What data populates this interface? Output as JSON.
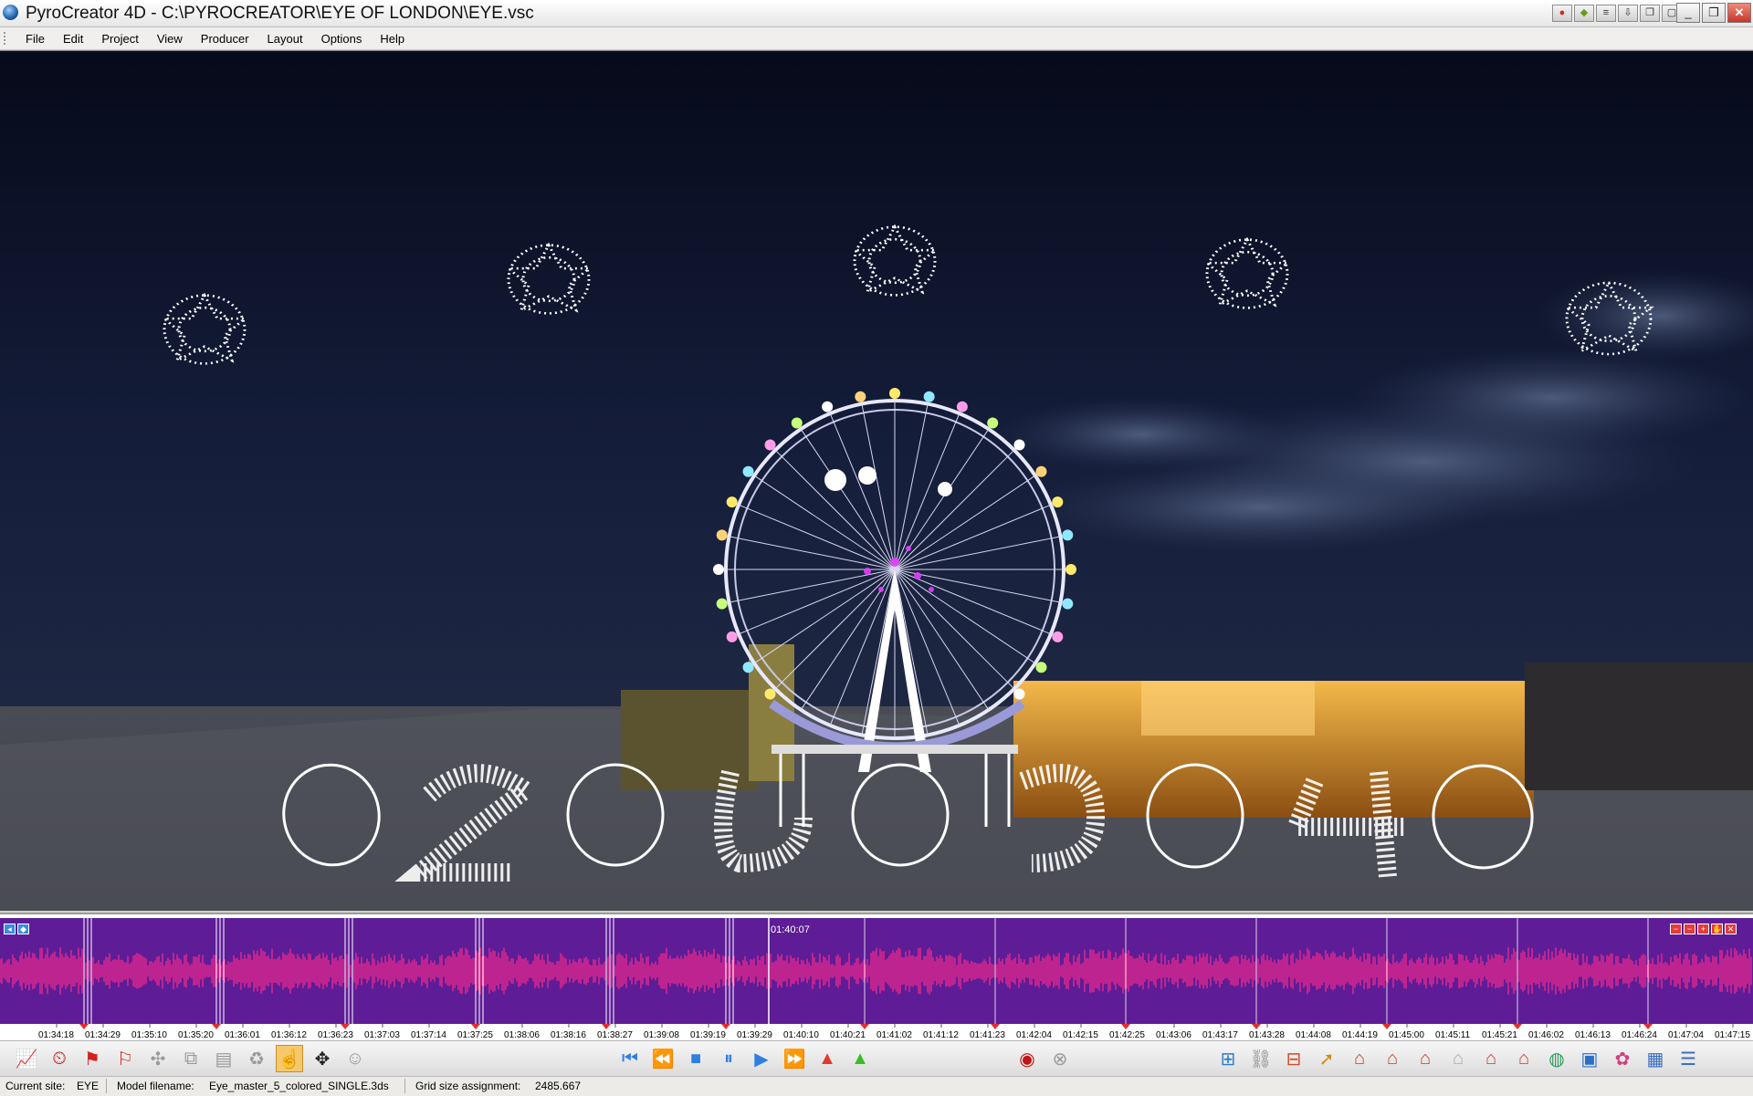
{
  "window": {
    "title": "PyroCreator 4D - C:\\PYROCREATOR\\EYE OF LONDON\\EYE.vsc"
  },
  "menu": {
    "items": [
      "File",
      "Edit",
      "Project",
      "View",
      "Producer",
      "Layout",
      "Options",
      "Help"
    ]
  },
  "timeline": {
    "playhead_time": "01:40:07",
    "tick_labels": [
      "01:34:18",
      "01:34:29",
      "01:35:10",
      "01:35:20",
      "01:36:01",
      "01:36:12",
      "01:36:23",
      "01:37:03",
      "01:37:14",
      "01:37:25",
      "01:38:06",
      "01:38:16",
      "01:38:27",
      "01:39:08",
      "01:39:19",
      "01:39:29",
      "01:40:10",
      "01:40:21",
      "01:41:02",
      "01:41:12",
      "01:41:23",
      "01:42:04",
      "01:42:15",
      "01:42:25",
      "01:43:06",
      "01:43:17",
      "01:43:28",
      "01:44:08",
      "01:44:19",
      "01:45:00",
      "01:45:11",
      "01:45:21",
      "01:46:02",
      "01:46:13",
      "01:46:24",
      "01:47:04",
      "01:47:15"
    ],
    "colors": {
      "background": "#5e1d97",
      "waveform": "#ff2a8a",
      "marker": "#e03030"
    }
  },
  "toolbar": {
    "left_tools": [
      "chart-edit-icon",
      "clock-icon",
      "red-flag-icon",
      "red-flag-a-icon",
      "puzzle-icon",
      "copy-icon",
      "paste-icon",
      "recycle-icon",
      "hand-pointer-icon",
      "move-arrows-icon",
      "person-icon"
    ],
    "transport": [
      "skip-start-icon",
      "rewind-icon",
      "stop-icon",
      "pause-icon",
      "play-icon",
      "fast-forward-icon",
      "red-triangle-icon",
      "green-triangle-icon"
    ],
    "record": [
      "record-icon",
      "disabled-record-icon"
    ],
    "right_tools": [
      "network-icon",
      "link-icon",
      "hierarchy-icon",
      "pointer-icon",
      "house-icon",
      "house-arrow-icon",
      "house-cross-icon",
      "house-faded-icon",
      "house-plus-icon",
      "house-add-icon",
      "globe-icon",
      "picture-icon",
      "palette-icon",
      "grid-icon",
      "list-icon"
    ]
  },
  "status": {
    "site_label": "Current site:",
    "site_value": "EYE",
    "model_label": "Model filename:",
    "model_value": "Eye_master_5_colored_SINGLE.3ds",
    "grid_label": "Grid size assignment:",
    "grid_value": "2485.667"
  }
}
